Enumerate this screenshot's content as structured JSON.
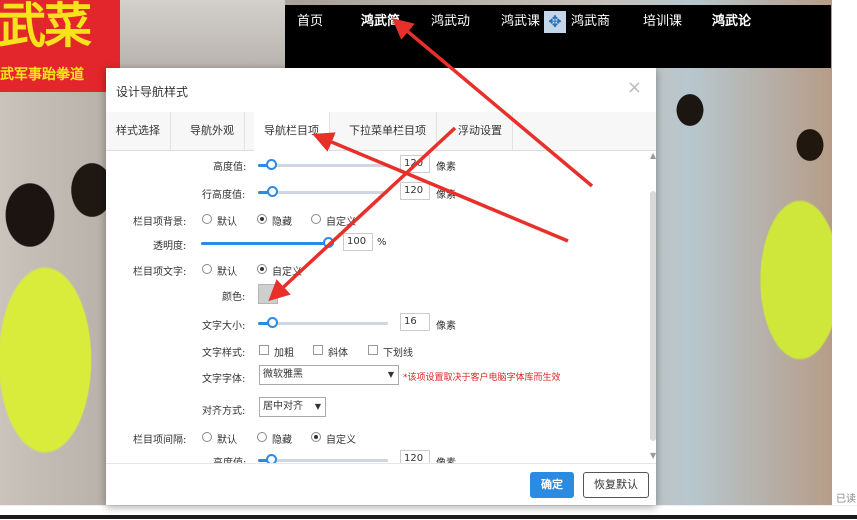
{
  "banner": {
    "big_text": "武菜",
    "sub_text": "武军事跆拳道"
  },
  "nav": {
    "items": [
      {
        "label": "首页",
        "bold": false
      },
      {
        "label": "鸿武简",
        "bold": true
      },
      {
        "label": "鸿武动",
        "bold": false
      },
      {
        "label": "鸿武课",
        "bold": false
      },
      {
        "label": "鸿武商",
        "bold": false
      },
      {
        "label": "培训课",
        "bold": false
      },
      {
        "label": "鸿武论",
        "bold": true
      }
    ],
    "move_icon": "move-cross-icon"
  },
  "side_text": "已读",
  "dialog": {
    "title": "设计导航样式",
    "close": "×",
    "tabs": [
      "样式选择",
      "导航外观",
      "导航栏目项",
      "下拉菜单栏目项",
      "浮动设置"
    ],
    "active_tab": 2,
    "rows": {
      "height_label": "高度值:",
      "height_value": "120",
      "height_unit": "像素",
      "line_height_label": "行高度值:",
      "line_height_value": "120",
      "line_height_unit": "像素",
      "item_bg_label": "栏目项背景:",
      "item_bg_options": [
        "默认",
        "隐藏",
        "自定义"
      ],
      "item_bg_selected": 1,
      "opacity_label": "透明度:",
      "opacity_value": "100",
      "opacity_unit": "%",
      "item_text_label": "栏目项文字:",
      "item_text_options": [
        "默认",
        "自定义"
      ],
      "item_text_selected": 1,
      "color_label": "颜色:",
      "font_size_label": "文字大小:",
      "font_size_value": "16",
      "font_size_unit": "像素",
      "text_style_label": "文字样式:",
      "text_style_options": [
        "加粗",
        "斜体",
        "下划线"
      ],
      "font_family_label": "文字字体:",
      "font_family_value": "微软雅黑",
      "font_hint": "*该项设置取决于客户电脑字体库而生效",
      "align_label": "对齐方式:",
      "align_value": "居中对齐",
      "spacing_label": "栏目项间隔:",
      "spacing_options": [
        "默认",
        "隐藏",
        "自定义"
      ],
      "spacing_selected": 2,
      "spacing_height_label": "高度值:",
      "spacing_height_value": "120",
      "spacing_height_unit": "像素"
    },
    "buttons": {
      "ok": "确定",
      "reset": "恢复默认"
    }
  },
  "colors": {
    "accent": "#2b8ae2",
    "arrow": "#e8302a",
    "swatch": "#cfcfcf"
  }
}
